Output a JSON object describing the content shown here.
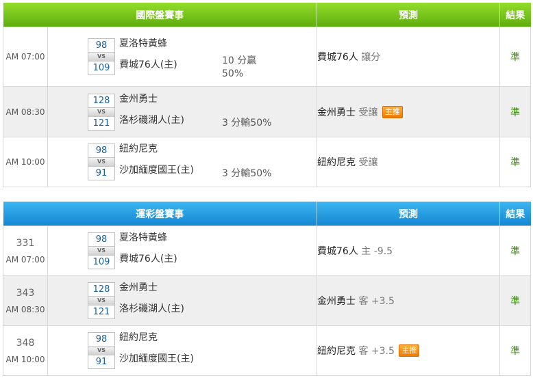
{
  "intl": {
    "headers": {
      "match": "國際盤賽事",
      "pred": "預測",
      "res": "結果"
    },
    "rows": [
      {
        "time": "AM 07:00",
        "score1": "98",
        "score2": "109",
        "vs": "VS",
        "team1": "夏洛特黃蜂",
        "team2": "費城76人(主)",
        "line_a": "10 分贏",
        "line_b": "50%",
        "pred_team": "費城76人",
        "pred_text": "讓分",
        "badge": "",
        "result": "準"
      },
      {
        "time": "AM 08:30",
        "score1": "128",
        "score2": "121",
        "vs": "VS",
        "team1": "金州勇士",
        "team2": "洛杉磯湖人(主)",
        "line": "3 分輸50%",
        "pred_team": "金州勇士",
        "pred_text": "受讓",
        "badge": "主推",
        "result": "準"
      },
      {
        "time": "AM 10:00",
        "score1": "98",
        "score2": "91",
        "vs": "VS",
        "team1": "紐約尼克",
        "team2": "沙加緬度國王(主)",
        "line": "3 分輸50%",
        "pred_team": "紐約尼克",
        "pred_text": "受讓",
        "badge": "",
        "result": "準"
      }
    ]
  },
  "lottery": {
    "headers": {
      "match": "運彩盤賽事",
      "pred": "預測",
      "res": "結果"
    },
    "rows": [
      {
        "no": "331",
        "time": "AM 07:00",
        "score1": "98",
        "score2": "109",
        "vs": "VS",
        "team1": "夏洛特黃蜂",
        "team2": "費城76人(主)",
        "pred_team": "費城76人",
        "pred_text": "主 -9.5",
        "badge": "",
        "result": "準"
      },
      {
        "no": "343",
        "time": "AM 08:30",
        "score1": "128",
        "score2": "121",
        "vs": "VS",
        "team1": "金州勇士",
        "team2": "洛杉磯湖人(主)",
        "pred_team": "金州勇士",
        "pred_text": "客 +3.5",
        "badge": "",
        "result": "準"
      },
      {
        "no": "348",
        "time": "AM 10:00",
        "score1": "98",
        "score2": "91",
        "vs": "VS",
        "team1": "紐約尼克",
        "team2": "沙加緬度國王(主)",
        "pred_team": "紐約尼克",
        "pred_text": "客 +3.5",
        "badge": "主推",
        "result": "準"
      }
    ]
  }
}
